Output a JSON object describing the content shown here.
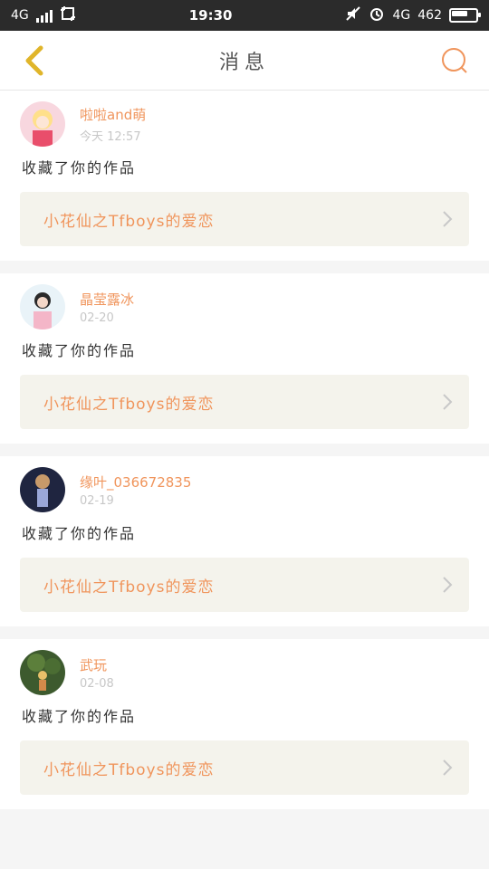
{
  "status_bar": {
    "left_network": "4G",
    "time": "19:30",
    "right_network": "4G",
    "right_text": "462"
  },
  "header": {
    "title": "消息"
  },
  "colors": {
    "accent": "#f0955c",
    "back_arrow": "#e0b52a",
    "link_bg": "#f4f3ec"
  },
  "messages": [
    {
      "username": "啦啦and萌",
      "time": "今天 12:57",
      "action": "收藏了你的作品",
      "work_title": "小花仙之Tfboys的爱恋"
    },
    {
      "username": "晶莹露冰",
      "time": "02-20",
      "action": "收藏了你的作品",
      "work_title": "小花仙之Tfboys的爱恋"
    },
    {
      "username": "缘叶_036672835",
      "time": "02-19",
      "action": "收藏了你的作品",
      "work_title": "小花仙之Tfboys的爱恋"
    },
    {
      "username": "武玩",
      "time": "02-08",
      "action": "收藏了你的作品",
      "work_title": "小花仙之Tfboys的爱恋"
    }
  ]
}
